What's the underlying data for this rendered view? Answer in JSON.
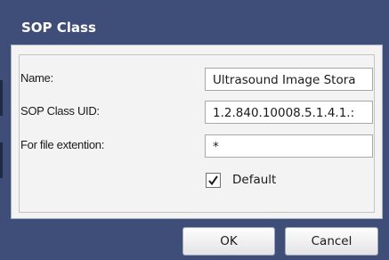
{
  "dialog": {
    "title": "SOP Class"
  },
  "form": {
    "name_label": "Name:",
    "name_value": "Ultrasound Image Storа",
    "uid_label": "SOP Class UID:",
    "uid_value": "1.2.840.10008.5.1.4.1.:",
    "ext_label": "For file extention:",
    "ext_value": "*",
    "default_label": "Default",
    "default_checked": true
  },
  "buttons": {
    "ok_label": "OK",
    "cancel_label": "Cancel"
  },
  "colors": {
    "frame": "#3f4e78",
    "panel": "#f3f3f3"
  }
}
